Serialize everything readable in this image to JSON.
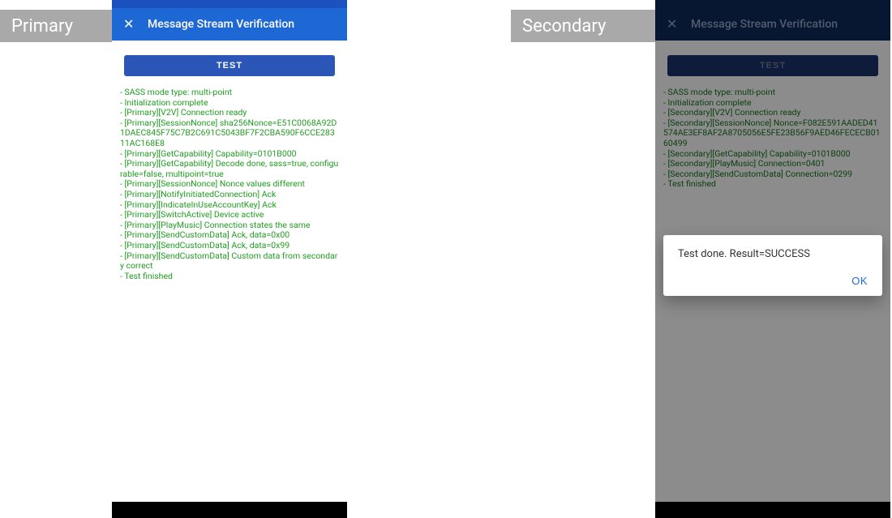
{
  "labels": {
    "primary": "Primary",
    "secondary": "Secondary"
  },
  "appbar": {
    "title": "Message Stream Verification",
    "close_icon": "✕"
  },
  "button": {
    "test": "TEST"
  },
  "primary_log": [
    "SASS mode type: multi-point",
    "Initialization complete",
    "[Primary][V2V] Connection ready",
    "[Primary][SessionNonce] sha256Nonce=E51C0068A92D1DAEC845F75C7B2C691C5043BF7F2CBA590F6CCE28311AC168E8",
    "[Primary][GetCapability] Capability=0101B000",
    "[Primary][GetCapability] Decode done, sass=true, configurable=false, multipoint=true",
    "[Primary][SessionNonce] Nonce values different",
    "[Primary][NotifyInitiatedConnection] Ack",
    "[Primary][IndicateInUseAccountKey] Ack",
    "[Primary][SwitchActive] Device active",
    "[Primary][PlayMusic] Connection states the same",
    "[Primary][SendCustomData] Ack, data=0x00",
    "[Primary][SendCustomData] Ack, data=0x99",
    "[Primary][SendCustomData] Custom data from secondary correct",
    "Test finished"
  ],
  "secondary_log": [
    "SASS mode type: multi-point",
    "Initialization complete",
    "[Secondary][V2V] Connection ready",
    "[Secondary][SessionNonce] Nonce=F082E591AADED41574AE3EF8AF2A8705056E5FE23B56F9AED46FECECB0160499",
    "[Secondary][GetCapability] Capability=0101B000",
    "[Secondary][PlayMusic] Connection=0401",
    "[Secondary][SendCustomData] Connection=0299",
    "Test finished"
  ],
  "dialog": {
    "message": "Test done. Result=SUCCESS",
    "ok": "OK"
  }
}
